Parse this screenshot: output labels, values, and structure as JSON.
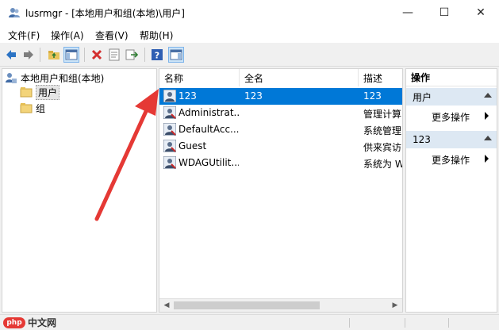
{
  "window": {
    "title": "lusrmgr - [本地用户和组(本地)\\用户]",
    "min_glyph": "—",
    "max_glyph": "☐",
    "close_glyph": "✕"
  },
  "menu": [
    "文件(F)",
    "操作(A)",
    "查看(V)",
    "帮助(H)"
  ],
  "toolbar": [
    "back-icon",
    "forward-icon",
    "up-folder-icon",
    "show-hide-tree-icon",
    "delete-icon",
    "properties-icon",
    "export-icon",
    "help-icon",
    "show-hide-action-pane-icon"
  ],
  "tree": {
    "root": "本地用户和组(本地)",
    "items": [
      "用户",
      "组"
    ],
    "selected": "用户"
  },
  "list": {
    "columns": [
      "名称",
      "全名",
      "描述"
    ],
    "rows": [
      {
        "name": "123",
        "fullname": "123",
        "desc": "123"
      },
      {
        "name": "Administrat...",
        "fullname": "",
        "desc": "管理计算"
      },
      {
        "name": "DefaultAcc...",
        "fullname": "",
        "desc": "系统管理"
      },
      {
        "name": "Guest",
        "fullname": "",
        "desc": "供来宾访"
      },
      {
        "name": "WDAGUtilit...",
        "fullname": "",
        "desc": "系统为 W"
      }
    ],
    "selected_index": 0
  },
  "actions": {
    "header": "操作",
    "groups": [
      {
        "title": "用户",
        "item": "更多操作"
      },
      {
        "title": "123",
        "item": "更多操作"
      }
    ]
  },
  "watermark": {
    "logo": "php",
    "text": "中文网"
  },
  "colors": {
    "selection": "#0078d7",
    "annotation_arrow": "#e53935",
    "action_group_bg": "#dde8f3"
  }
}
